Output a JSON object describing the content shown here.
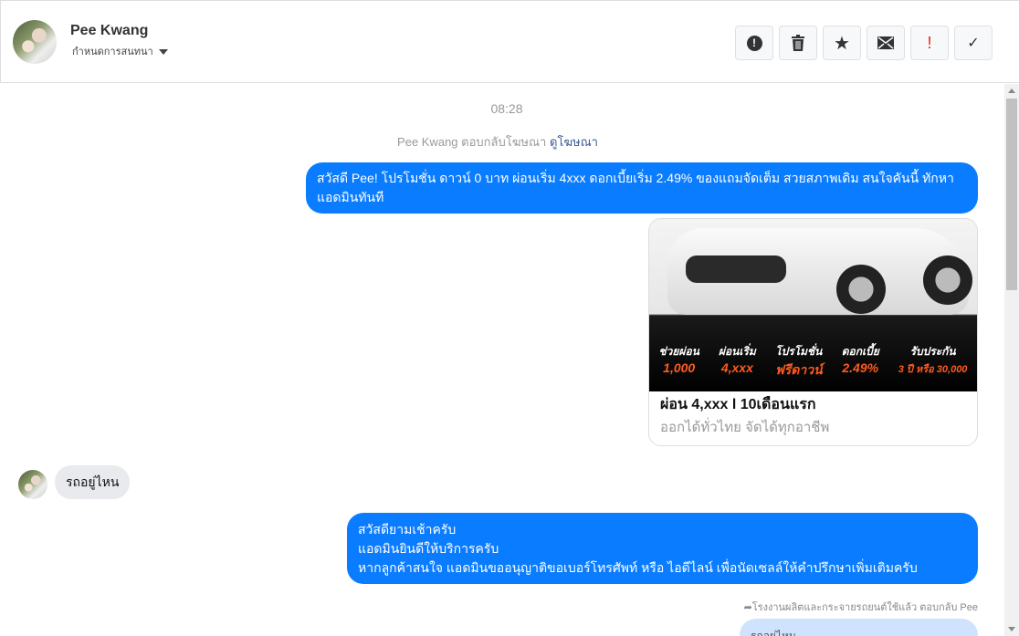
{
  "header": {
    "name": "Pee Kwang",
    "subtitle": "กำหนดการสนทนา",
    "buttons": [
      {
        "icon": "exclamation-circle-icon",
        "glyph": "●"
      },
      {
        "icon": "trash-icon",
        "glyph": "🗑"
      },
      {
        "icon": "star-icon",
        "glyph": "★"
      },
      {
        "icon": "envelope-icon",
        "glyph": "✉"
      },
      {
        "icon": "exclamation-icon",
        "glyph": "!"
      },
      {
        "icon": "check-icon",
        "glyph": "✓"
      }
    ]
  },
  "chat": {
    "timestamp": "08:28",
    "reply_prefix": "Pee Kwang ตอบกลับโฆษณา",
    "reply_link": "ดูโฆษณา",
    "msg1": "สวัสดี Pee! โปรโมชั่น ดาวน์ 0 บาท ผ่อนเริ่ม 4xxx ดอกเบี้ยเริ่ม 2.49% ของแถมจัดเต็ม สวยสภาพเดิม สนใจคันนี้ ทักหาแอดมินทันที",
    "card": {
      "promo": [
        {
          "label": "ช่วยผ่อน",
          "value": "1,000"
        },
        {
          "label": "ผ่อนเริ่ม",
          "value": "4,xxx"
        },
        {
          "label": "โปรโมชั่น",
          "value": "ฟรีดาวน์"
        },
        {
          "label": "ดอกเบี้ย",
          "value": "2.49%"
        },
        {
          "label": "รับประกัน",
          "value": "3 ปี หรือ 30,000"
        }
      ],
      "title": "ผ่อน 4,xxx l 10เดือนแรก",
      "description": "ออกได้ทั่วไทย จัดได้ทุกอาชีพ"
    },
    "incoming": "รถอยู่ไหน",
    "msg2_lines": [
      "สวัสดียามเช้าครับ",
      "แอดมินยินดีให้บริการครับ",
      "หากลูกค้าสนใจ แอดมินขออนุญาติขอเบอร์โทรศัพท์ หรือ ไอดีไลน์ เพื่อนัดเซลล์ให้คำปรึกษาเพิ่มเติมครับ"
    ],
    "reply_note": "โรงงานผลิตและกระจายรถยนต์ใช้แล้ว ตอบกลับ Pee",
    "quoted": "รถอยู่ไหน"
  },
  "colors": {
    "outgoing": "#0a7cff",
    "incoming": "#e9eaed",
    "quoted": "#cfe3ff"
  }
}
